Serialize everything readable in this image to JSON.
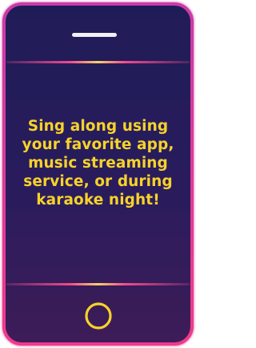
{
  "message": {
    "lines": [
      "Sing along using",
      "your favorite app,",
      "music streaming",
      "service, or during",
      "karaoke night!"
    ]
  },
  "colors": {
    "screen_top": "#1f1a58",
    "screen_bottom": "#3a1d5a",
    "frame_glow": "#e0389a",
    "accent_yellow": "#f7d22a"
  },
  "icons": {
    "speaker": "speaker-slot-icon",
    "home": "home-button-icon"
  }
}
